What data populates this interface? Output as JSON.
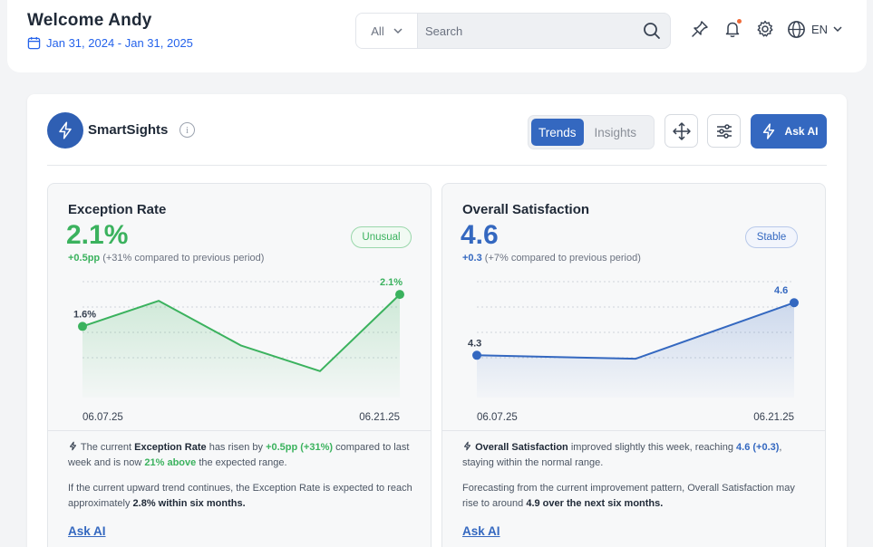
{
  "header": {
    "welcome": "Welcome  Andy",
    "date_range": "Jan 31, 2024 - Jan 31, 2025",
    "search_scope": "All",
    "search_placeholder": "Search",
    "language": "EN",
    "icons": [
      "pin-icon",
      "bell-icon",
      "gear-icon",
      "globe-icon"
    ],
    "accent": "#2563eb"
  },
  "card": {
    "brand": "SmartSights",
    "tabs": [
      {
        "label": "Trends",
        "active": true
      },
      {
        "label": "Insights",
        "active": false
      }
    ],
    "ask_ai_label": "Ask AI"
  },
  "panels": [
    {
      "title": "Exception Rate",
      "value": "2.1%",
      "delta_main": "+0.5pp",
      "delta_rest": " (+31% compared to previous period)",
      "badge": "Unusual",
      "color": "#3bb25e",
      "chart_data": {
        "type": "area",
        "x": [
          "06.07.25",
          "",
          "",
          "",
          "06.21.25"
        ],
        "values": [
          1.6,
          2.0,
          1.3,
          0.9,
          2.1
        ],
        "labels_shown": {
          "first": "1.6%",
          "last": "2.1%"
        },
        "x_ticks": [
          "06.07.25",
          "06.21.25"
        ]
      },
      "text1": {
        "p1": " The current ",
        "b1": "Exception Rate",
        "p2": " has risen by ",
        "g1": "+0.5pp (+31%)",
        "p3": " compared to last week and is now ",
        "g2": "21% above",
        "p4": " the expected range."
      },
      "text2": {
        "p1": "If the current upward trend continues, the Exception Rate is expected to reach approximately ",
        "b1": "2.8% within six months."
      },
      "link": "Ask AI"
    },
    {
      "title": "Overall Satisfaction",
      "value": "4.6",
      "delta_main": "+0.3",
      "delta_rest": " (+7% compared to previous period)",
      "badge": "Stable",
      "color": "#3468c0",
      "chart_data": {
        "type": "area",
        "x": [
          "06.07.25",
          "",
          "06.21.25"
        ],
        "values": [
          4.3,
          4.28,
          4.6
        ],
        "labels_shown": {
          "first": "4.3",
          "last": "4.6"
        },
        "x_ticks": [
          "06.07.25",
          "06.21.25"
        ]
      },
      "text1": {
        "b1": "Overall Satisfaction",
        "p1": " improved slightly this week, reaching ",
        "v1": "4.6 (+0.3)",
        "p2": ", staying within the normal range."
      },
      "text2": {
        "p1": "Forecasting from the current improvement pattern, Overall Satisfaction may rise to around ",
        "b1": "4.9 over the next six months."
      },
      "link": "Ask AI"
    }
  ]
}
